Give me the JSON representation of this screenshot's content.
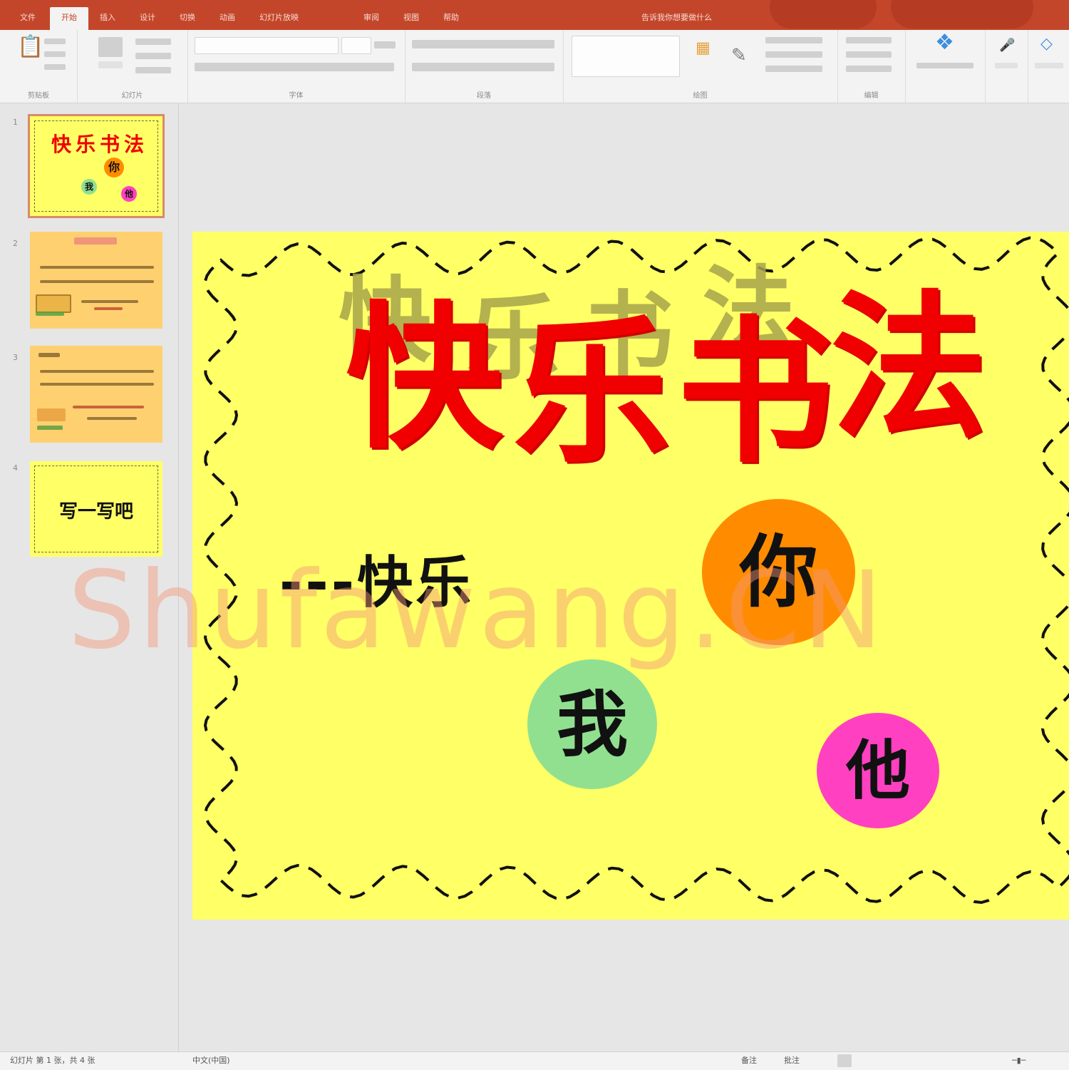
{
  "app": {
    "tabs": [
      "文件",
      "开始",
      "插入",
      "设计",
      "切换",
      "动画",
      "幻灯片放映",
      "审阅",
      "视图",
      "帮助",
      "告诉我你想要做什么"
    ],
    "active_tab_index": 1
  },
  "ribbon": {
    "groups": [
      "剪贴板",
      "幻灯片",
      "字体",
      "段落",
      "绘图",
      "编辑"
    ]
  },
  "thumbnails": [
    {
      "number": "1",
      "selected": true,
      "title": "快乐书法",
      "circles": [
        "你",
        "我",
        "他"
      ]
    },
    {
      "number": "2",
      "selected": false
    },
    {
      "number": "3",
      "selected": false
    },
    {
      "number": "4",
      "selected": false,
      "title": "写一写吧"
    }
  ],
  "slide": {
    "background": "#ffff66",
    "title_chars": [
      "快",
      "乐",
      "书",
      "法"
    ],
    "shadow_chars": [
      "快",
      "乐",
      "书",
      "法"
    ],
    "subtitle": "---快乐",
    "circles": [
      {
        "char": "你",
        "color": "#ff8c00"
      },
      {
        "char": "我",
        "color": "#90e090"
      },
      {
        "char": "他",
        "color": "#ff40c0"
      }
    ]
  },
  "watermark": "Shufawang.CN",
  "statusbar": {
    "slide_info": "幻灯片 第 1 张，共 4 张",
    "language": "中文(中国)",
    "notes": "备注",
    "comments": "批注"
  },
  "colors": {
    "titlebar": "#c4462a",
    "title_red": "#f00000",
    "orange": "#ff8c00",
    "green": "#90e090",
    "pink": "#ff40c0"
  }
}
